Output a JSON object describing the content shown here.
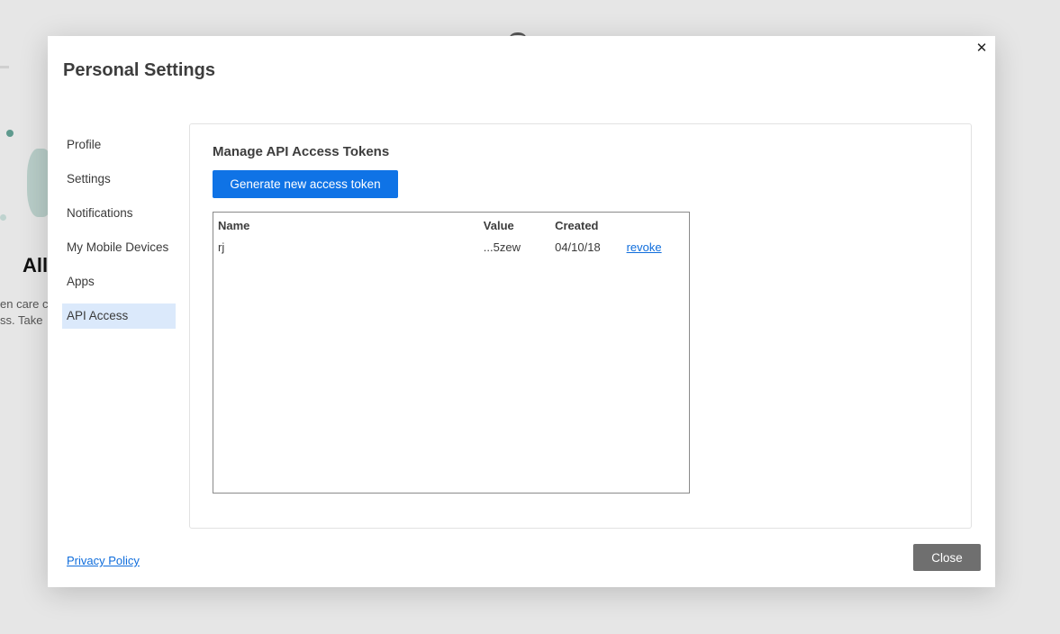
{
  "background": {
    "heading_fragment": "All",
    "text_fragment_1": "en care c",
    "text_fragment_2": "ss. Take"
  },
  "modal": {
    "title": "Personal Settings",
    "close_icon": "close-icon"
  },
  "sidebar": {
    "items": [
      {
        "label": "Profile",
        "active": false
      },
      {
        "label": "Settings",
        "active": false
      },
      {
        "label": "Notifications",
        "active": false
      },
      {
        "label": "My Mobile Devices",
        "active": false
      },
      {
        "label": "Apps",
        "active": false
      },
      {
        "label": "API Access",
        "active": true
      }
    ]
  },
  "api_access": {
    "section_title": "Manage API Access Tokens",
    "generate_button_label": "Generate new access token",
    "table": {
      "columns": [
        "Name",
        "Value",
        "Created",
        ""
      ],
      "rows": [
        {
          "name": "rj",
          "value": "...5zew",
          "created": "04/10/18",
          "action": "revoke"
        }
      ]
    }
  },
  "footer": {
    "privacy_policy_label": "Privacy Policy",
    "close_button_label": "Close"
  },
  "colors": {
    "accent": "#0f73e6",
    "active_nav_bg": "#dbe9fb",
    "link": "#0f6ddc",
    "close_button": "#6f6f6f"
  }
}
